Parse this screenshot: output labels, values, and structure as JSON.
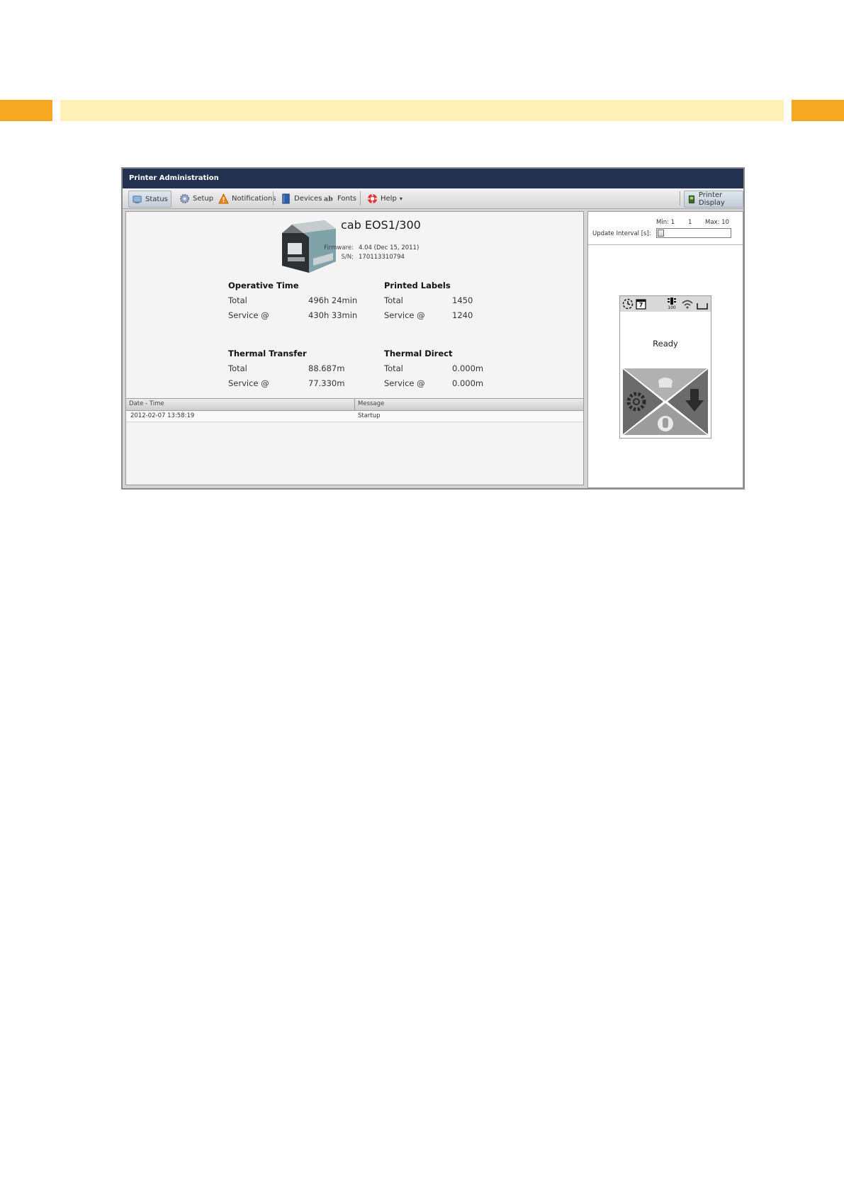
{
  "header_bands": {
    "left": "#f7a823",
    "middle": "#fdf1b8",
    "right": "#f7a823"
  },
  "window": {
    "title": "Printer Administration",
    "title_bg": "#233250"
  },
  "toolbar": {
    "status": {
      "label": "Status",
      "icon": "status-icon"
    },
    "setup": {
      "label": "Setup",
      "icon": "gear-icon"
    },
    "notifications": {
      "label": "Notifications",
      "icon": "warning-icon"
    },
    "devices": {
      "label": "Devices",
      "icon": "device-book-icon"
    },
    "fonts": {
      "label": "Fonts",
      "icon": "fonts-icon"
    },
    "help": {
      "label": "Help",
      "icon": "lifebuoy-icon",
      "arrow": "▾"
    },
    "printer_display": {
      "label": "Printer Display",
      "icon": "display-icon"
    }
  },
  "printer": {
    "model": "cab EOS1/300",
    "firmware_label": "Firmware:",
    "firmware_value": "4.04 (Dec 15, 2011)",
    "serial_label": "S/N:",
    "serial_value": "170113310794"
  },
  "stats": {
    "operative_time": {
      "title": "Operative Time",
      "total_label": "Total",
      "total": "496h 24min",
      "service_label": "Service @",
      "service": "430h 33min"
    },
    "printed_labels": {
      "title": "Printed Labels",
      "total_label": "Total",
      "total": "1450",
      "service_label": "Service @",
      "service": "1240"
    },
    "thermal_transfer": {
      "title": "Thermal Transfer",
      "total_label": "Total",
      "total": "88.687m",
      "service_label": "Service @",
      "service": "77.330m"
    },
    "thermal_direct": {
      "title": "Thermal Direct",
      "total_label": "Total",
      "total": "0.000m",
      "service_label": "Service @",
      "service": "0.000m"
    }
  },
  "log": {
    "columns": [
      "Date - Time",
      "Message"
    ],
    "rows": [
      {
        "datetime": "2012-02-07 13:58:19",
        "message": "Startup"
      }
    ]
  },
  "update_interval": {
    "min_label": "Min: 1",
    "current": "1",
    "max_label": "Max: 10",
    "label": "Update Interval [s]:",
    "value_fraction": 0
  },
  "display": {
    "status_text": "Ready",
    "calendar_day": "7",
    "memory_value": "100",
    "icons": [
      "clock-icon",
      "calendar-icon",
      "memory-icon",
      "wifi-icon",
      "tray-icon"
    ],
    "buttons": [
      "pause-icon",
      "settings-icon",
      "feed-icon",
      "cancel-icon"
    ]
  }
}
